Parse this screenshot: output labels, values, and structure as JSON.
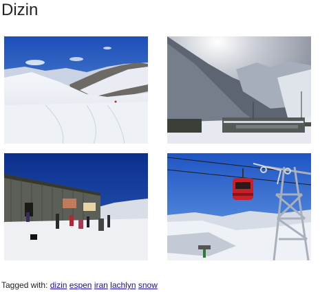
{
  "page": {
    "title": "Dizin"
  },
  "gallery": {
    "photos": [
      {
        "name": "photo-1",
        "icon": "ski-slope-photo"
      },
      {
        "name": "photo-2",
        "icon": "mountain-valley-photo"
      },
      {
        "name": "photo-3",
        "icon": "ski-lodge-photo"
      },
      {
        "name": "photo-4",
        "icon": "gondola-lift-photo"
      }
    ]
  },
  "tags": {
    "label": "Tagged with:",
    "items": [
      "dizin",
      "espen",
      "iran",
      "lachlyn",
      "snow"
    ]
  }
}
